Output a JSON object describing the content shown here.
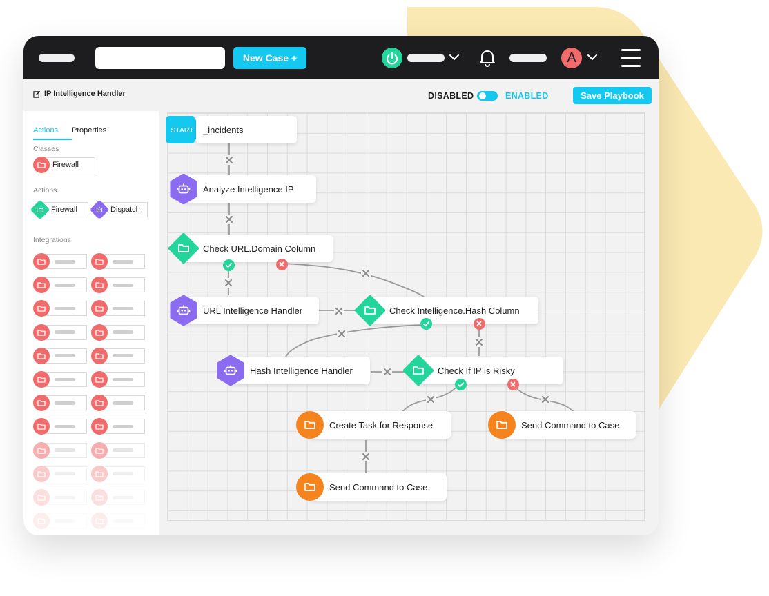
{
  "header": {
    "new_case_label": "New Case +",
    "avatar_initial": "A",
    "accent": "#14C8F0",
    "icons": [
      "power-icon",
      "chevron-down-icon",
      "bell-icon",
      "hamburger-menu-icon"
    ]
  },
  "subheader": {
    "playbook_title": "IP Intelligence Handler",
    "disabled_label": "DISABLED",
    "enabled_label": "ENABLED",
    "save_label": "Save Playbook"
  },
  "sidebar": {
    "tabs": [
      "Actions",
      "Properties"
    ],
    "classes_label": "Classes",
    "classes": [
      {
        "label": "Firewall",
        "icon": "folder-icon",
        "color": "#F06B6B"
      }
    ],
    "actions_label": "Actions",
    "actions": [
      {
        "label": "Firewall",
        "icon": "folder-icon",
        "color": "#23D59A"
      },
      {
        "label": "Dispatch",
        "icon": "robot-icon",
        "color": "#8B6CF0"
      }
    ],
    "integrations_label": "Integrations"
  },
  "flow": {
    "start_tag": "START",
    "nodes": [
      {
        "id": "incidents",
        "label": "_incidents"
      },
      {
        "id": "analyze",
        "label": "Analyze Intelligence IP",
        "kind": "robot"
      },
      {
        "id": "check-url",
        "label": "Check URL.Domain Column",
        "kind": "condition"
      },
      {
        "id": "url-handler",
        "label": "URL Intelligence Handler",
        "kind": "robot"
      },
      {
        "id": "check-hash",
        "label": "Check Intelligence.Hash Column",
        "kind": "condition"
      },
      {
        "id": "hash-handler",
        "label": "Hash Intelligence Handler",
        "kind": "robot"
      },
      {
        "id": "check-risky",
        "label": "Check If IP is Risky",
        "kind": "condition"
      },
      {
        "id": "create-task",
        "label": "Create Task for Response",
        "kind": "action"
      },
      {
        "id": "send-command-1",
        "label": "Send Command to Case",
        "kind": "action"
      },
      {
        "id": "send-command-2",
        "label": "Send Command to Case",
        "kind": "action"
      }
    ],
    "colors": {
      "robot": "#8B6CF0",
      "condition": "#23D59A",
      "action": "#F5841F",
      "true": "#23D59A",
      "false": "#F06B6B"
    }
  }
}
